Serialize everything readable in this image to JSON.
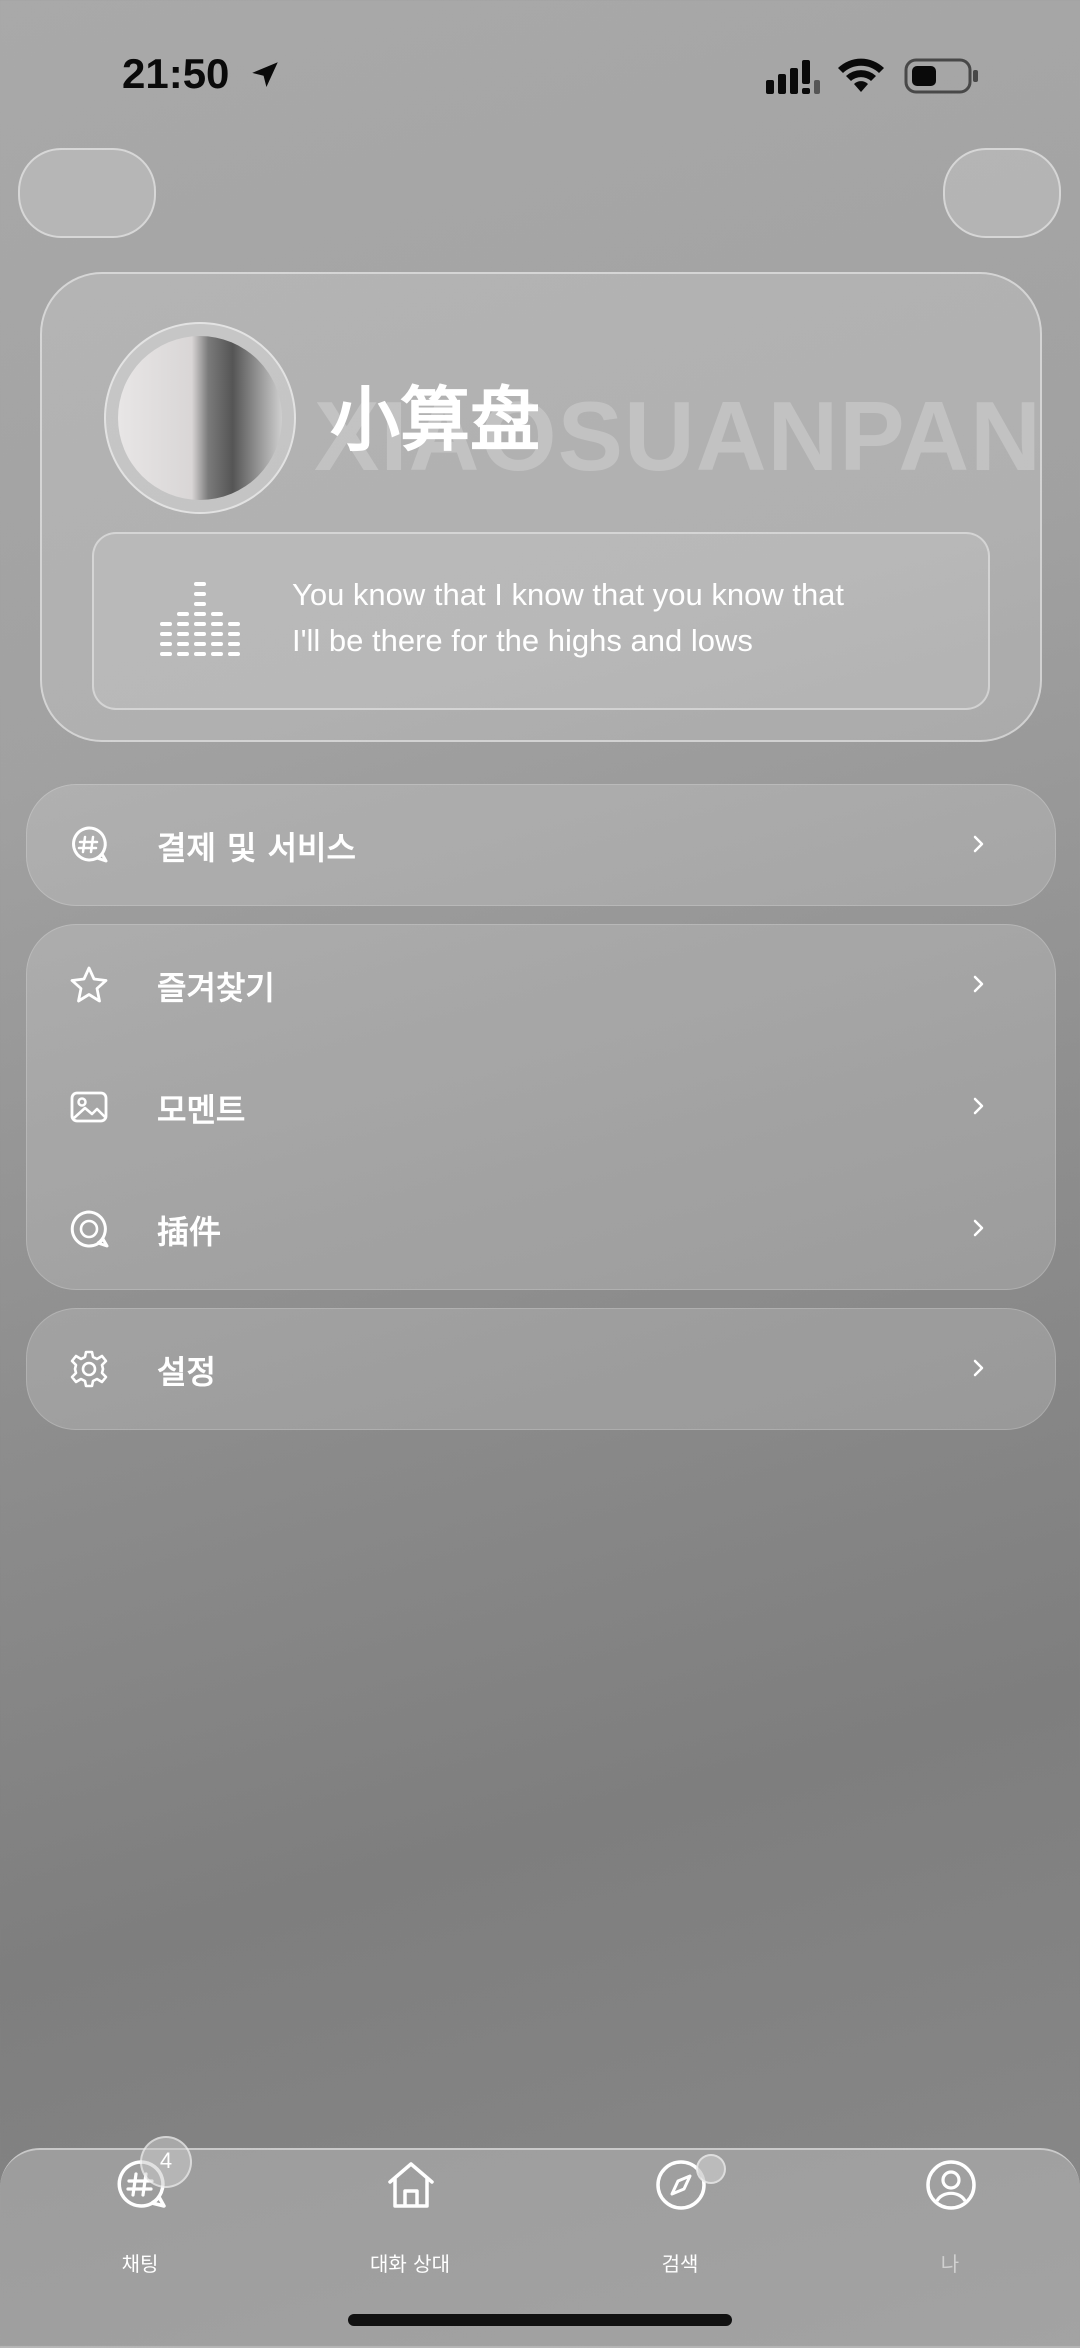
{
  "status_bar": {
    "time": "21:50"
  },
  "profile": {
    "name": "小算盘",
    "watermark": "XIAOSUANPAN",
    "lyric_line1": "You know that I know that you know that",
    "lyric_line2": "I'll be there for the highs and lows"
  },
  "menu": {
    "payment": "결제 및 서비스",
    "favorites": "즐겨찾기",
    "moments": "모멘트",
    "plugins": "插件",
    "settings": "설정"
  },
  "tabs": [
    {
      "label": "채팅",
      "badge": "4"
    },
    {
      "label": "대화 상대"
    },
    {
      "label": "검색"
    },
    {
      "label": "나"
    }
  ],
  "colors": {
    "background": "#9a9a9a",
    "text": "#ffffff"
  }
}
